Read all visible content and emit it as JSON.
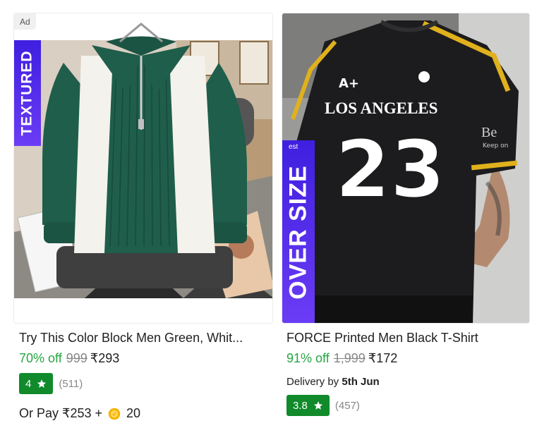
{
  "products": [
    {
      "ad_label": "Ad",
      "banner_text": "TEXTURED",
      "title": "Try This Color Block Men Green, Whit...",
      "discount": "70% off",
      "mrp": "999",
      "price": "₹293",
      "rating": "4",
      "rating_count": "(511)",
      "or_pay_text": "Or Pay ₹253 +",
      "coins": "20",
      "shirt_colors": {
        "green": "#1f5e4b",
        "cream": "#f3f2ec"
      }
    },
    {
      "banner_text": "OVER SIZE",
      "graphic_city": "LOS ANGELES",
      "graphic_number": "23",
      "graphic_sleeve": "Be",
      "graphic_sleeve_small": "Keep on",
      "banner_peek": "est",
      "title": "FORCE Printed Men Black T-Shirt",
      "discount": "91% off",
      "mrp": "1,999",
      "price": "₹172",
      "delivery_prefix": "Delivery by",
      "delivery_date": "5th Jun",
      "rating": "3.8",
      "rating_count": "(457)"
    }
  ],
  "colors": {
    "discount": "#26a541",
    "rating_badge": "#108a2b",
    "banner": "#4b2be8"
  }
}
